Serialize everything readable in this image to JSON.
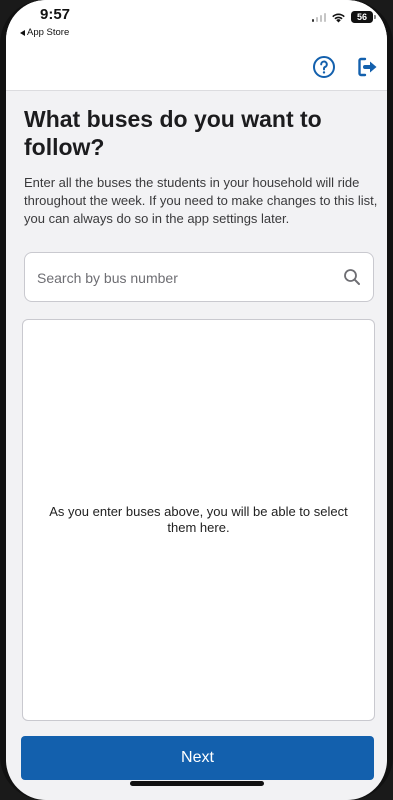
{
  "status_bar": {
    "time": "9:57",
    "back_app": "App Store",
    "battery": "56"
  },
  "header": {
    "help_icon": "question-circle",
    "logout_icon": "logout-arrow",
    "accent_color": "#1360ad"
  },
  "page": {
    "title": "What buses do you want to follow?",
    "description": "Enter all the buses the students in your household will ride throughout the week. If you need to make changes to this list, you can always do so in the app settings later."
  },
  "search": {
    "placeholder": "Search by bus number",
    "value": "",
    "icon": "search-icon"
  },
  "results": {
    "empty_message": "As you enter buses above, you will be able to select them here."
  },
  "footer": {
    "next_label": "Next",
    "button_color": "#1360ad"
  }
}
